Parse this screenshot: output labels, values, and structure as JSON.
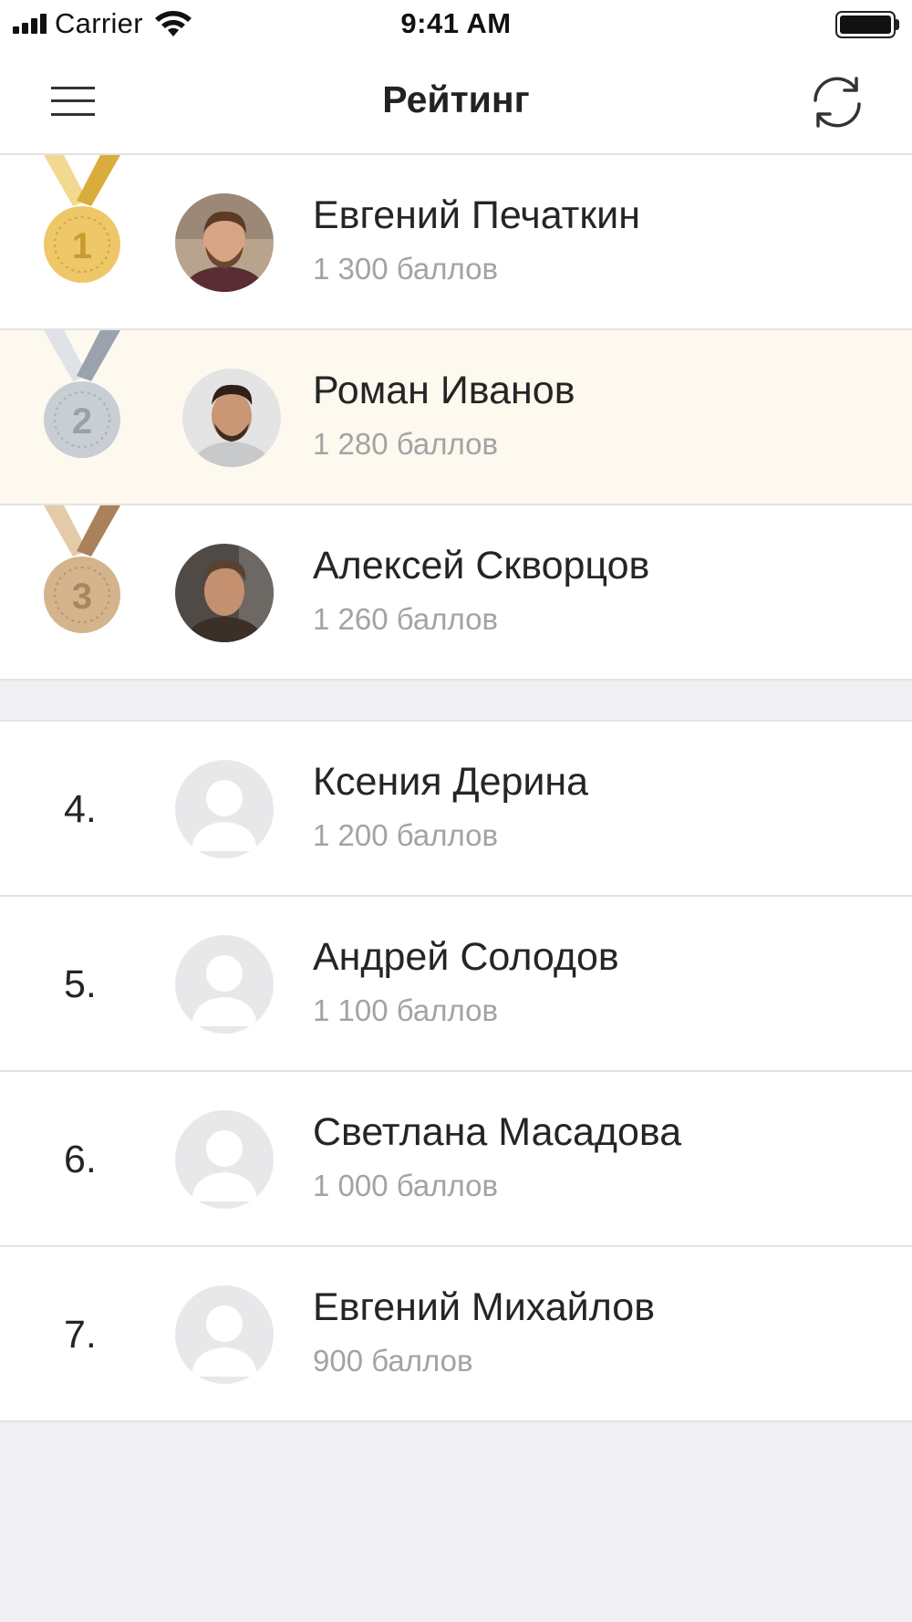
{
  "status_bar": {
    "carrier": "Carrier",
    "time": "9:41 AM"
  },
  "header": {
    "title": "Рейтинг",
    "menu_icon": "hamburger-menu-icon",
    "refresh_icon": "refresh-icon"
  },
  "colors": {
    "gold": "#eec769",
    "silver": "#c9ced5",
    "bronze": "#d4b48c",
    "highlight_row": "#fdf9ef",
    "score_text": "#a3a3a3"
  },
  "leaders": [
    {
      "rank": "1",
      "medal": "gold-medal-icon",
      "name": "Евгений Печаткин",
      "score": "1 300 баллов"
    },
    {
      "rank": "2",
      "medal": "silver-medal-icon",
      "name": "Роман Иванов",
      "score": "1 280 баллов",
      "highlighted": true
    },
    {
      "rank": "3",
      "medal": "bronze-medal-icon",
      "name": "Алексей Скворцов",
      "score": "1 260 баллов"
    }
  ],
  "others": [
    {
      "rank": "4.",
      "name": "Ксения Дерина",
      "score": "1 200 баллов"
    },
    {
      "rank": "5.",
      "name": "Андрей Солодов",
      "score": "1 100 баллов"
    },
    {
      "rank": "6.",
      "name": "Светлана Масадова",
      "score": "1 000 баллов"
    },
    {
      "rank": "7.",
      "name": "Евгений Михайлов",
      "score": "900 баллов"
    }
  ]
}
